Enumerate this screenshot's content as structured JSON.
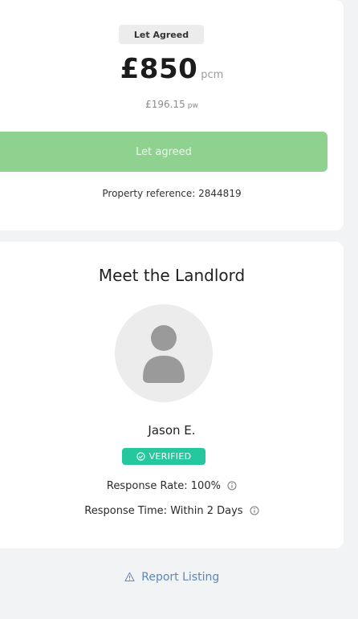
{
  "listing": {
    "status_badge": "Let Agreed",
    "price": "£850",
    "price_unit": "pcm",
    "price_week": "£196.15",
    "price_week_unit": "pw",
    "let_agreed_button": "Let agreed",
    "property_reference": "Property reference: 2844819"
  },
  "landlord": {
    "heading": "Meet the Landlord",
    "avatar_icon": "user-silhouette-icon",
    "name": "Jason E.",
    "verified_label": "VERIFIED",
    "response_rate": "Response Rate: 100%",
    "response_time": "Response Time: Within 2 Days"
  },
  "report": {
    "label": "Report Listing",
    "icon": "warning-triangle-icon"
  },
  "colors": {
    "page_background": "#f2f3f5",
    "card_background": "#ffffff",
    "let_agreed_green": "#8fd18f",
    "verified_teal": "#25c79f",
    "link_blue": "#5f86b8"
  }
}
